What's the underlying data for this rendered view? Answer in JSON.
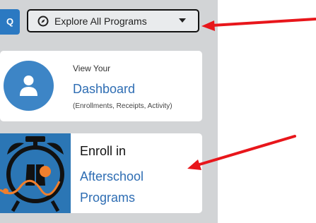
{
  "search": {
    "icon_text": "Q"
  },
  "explore": {
    "label": "Explore All Programs",
    "icon": "compass-icon"
  },
  "dashboard_card": {
    "pretitle": "View Your",
    "title": "Dashboard",
    "subtitle": "(Enrollments, Receipts, Activity)",
    "icon": "user-icon"
  },
  "enroll_card": {
    "pretitle": "Enroll in",
    "title": "Afterschool Programs",
    "image": "alarm-clock-illustration"
  },
  "colors": {
    "panel": "#d2d4d6",
    "accent_blue": "#2e6db3",
    "avatar_blue": "#3d85c6",
    "annotation_red": "#e8161b"
  }
}
